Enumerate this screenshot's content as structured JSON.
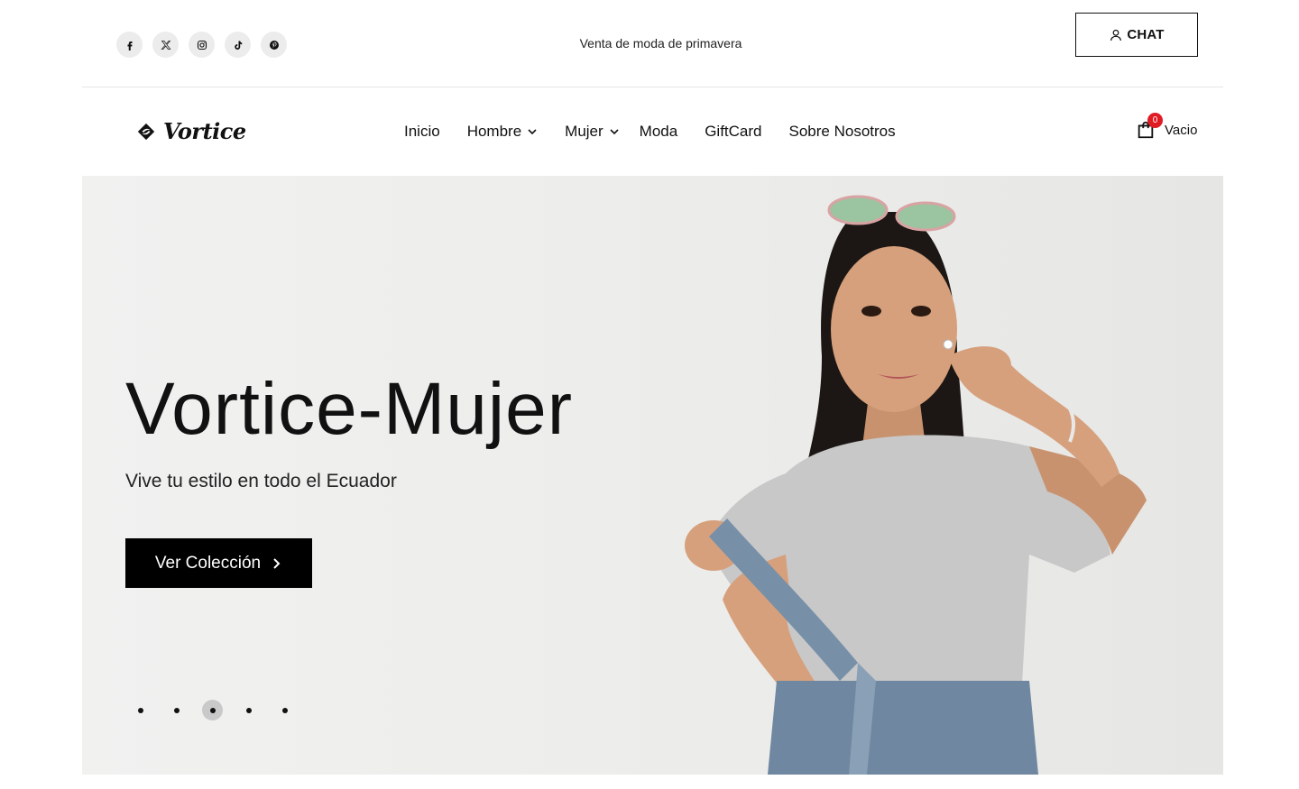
{
  "topbar": {
    "socials": [
      {
        "icon": "facebook-icon"
      },
      {
        "icon": "x-icon"
      },
      {
        "icon": "instagram-icon"
      },
      {
        "icon": "tiktok-icon"
      },
      {
        "icon": "pinterest-icon"
      }
    ],
    "promo": "Venta de moda de primavera",
    "chat_label": "CHAT"
  },
  "header": {
    "logo": "Vortice",
    "nav": [
      {
        "label": "Inicio",
        "dropdown": false
      },
      {
        "label": "Hombre",
        "dropdown": true
      },
      {
        "label": "Mujer",
        "dropdown": true
      },
      {
        "label": "Moda",
        "dropdown": false
      },
      {
        "label": "GiftCard",
        "dropdown": false
      },
      {
        "label": "Sobre Nosotros",
        "dropdown": false
      }
    ],
    "cart": {
      "count": "0",
      "label": "Vacio"
    }
  },
  "hero": {
    "title": "Vortice-Mujer",
    "subtitle": "Vive tu estilo en todo el Ecuador",
    "cta": "Ver Colección",
    "slides": 5,
    "active_slide": 3
  },
  "colors": {
    "accent": "#000000",
    "badge": "#e01b24",
    "hero_bg": "#ececea"
  }
}
